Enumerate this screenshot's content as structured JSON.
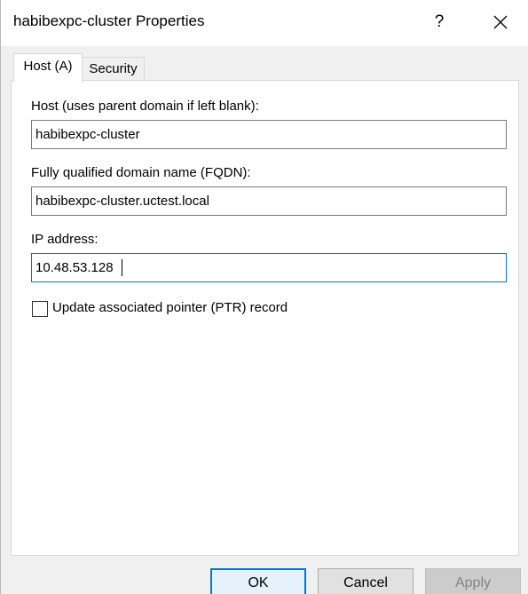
{
  "window": {
    "title": "habibexpc-cluster Properties",
    "help_glyph": "?",
    "close_icon": "close-icon"
  },
  "tabs": [
    {
      "label": "Host (A)",
      "selected": true
    },
    {
      "label": "Security",
      "selected": false
    }
  ],
  "host": {
    "label": "Host (uses parent domain if left blank):",
    "value": "habibexpc-cluster"
  },
  "fqdn": {
    "label": "Fully qualified domain name (FQDN):",
    "value": "habibexpc-cluster.uctest.local"
  },
  "ip": {
    "label": "IP address:",
    "value": "10.48.53.128"
  },
  "ptr": {
    "label": "Update associated pointer (PTR) record",
    "checked": false
  },
  "buttons": {
    "ok": "OK",
    "cancel": "Cancel",
    "apply": "Apply"
  },
  "colors": {
    "accent": "#0078d7",
    "dialog_bg": "#f0f0f0",
    "disabled_text": "#838383"
  }
}
